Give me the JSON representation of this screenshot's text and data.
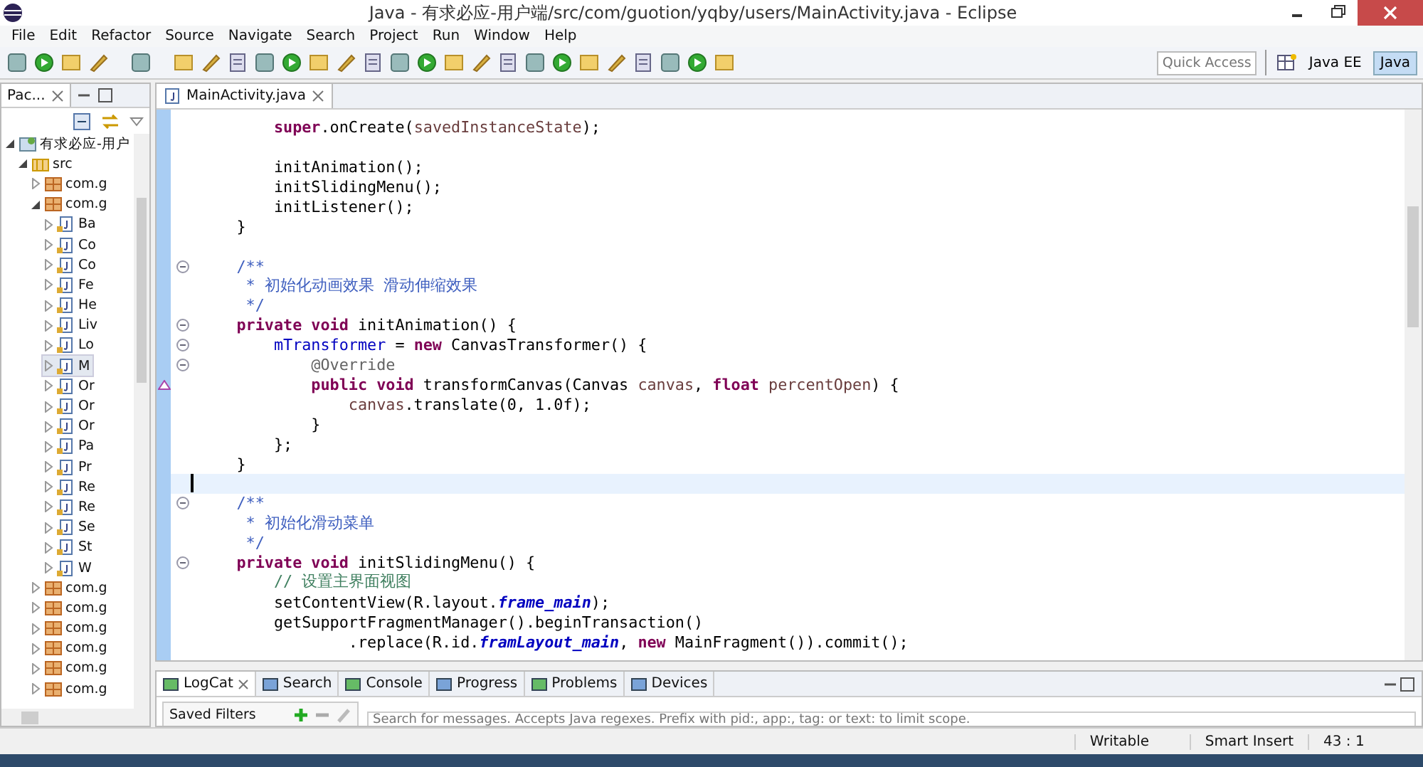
{
  "window": {
    "title": "Java - 有求必应-用户端/src/com/guotion/yqby/users/MainActivity.java - Eclipse"
  },
  "menu": [
    "File",
    "Edit",
    "Refactor",
    "Source",
    "Navigate",
    "Search",
    "Project",
    "Run",
    "Window",
    "Help"
  ],
  "quick_access": {
    "placeholder": "Quick Access"
  },
  "perspectives": [
    {
      "label": "Java EE",
      "selected": false
    },
    {
      "label": "Java",
      "selected": true
    }
  ],
  "package_explorer": {
    "tab": "Pac...",
    "tree": [
      {
        "label": "有求必应-用户",
        "kind": "project",
        "expanded": true,
        "selected": false,
        "children": [
          {
            "label": "src",
            "kind": "source-folder",
            "expanded": true,
            "selected": false,
            "children": [
              {
                "label": "com.g",
                "kind": "package",
                "expanded": false,
                "selected": false
              },
              {
                "label": "com.g",
                "kind": "package",
                "expanded": true,
                "selected": false,
                "children": [
                  {
                    "label": "Ba",
                    "kind": "class",
                    "expanded": false,
                    "selected": false
                  },
                  {
                    "label": "Co",
                    "kind": "class",
                    "expanded": false,
                    "selected": false
                  },
                  {
                    "label": "Co",
                    "kind": "class",
                    "expanded": false,
                    "selected": false
                  },
                  {
                    "label": "Fe",
                    "kind": "class",
                    "expanded": false,
                    "selected": false
                  },
                  {
                    "label": "He",
                    "kind": "class",
                    "expanded": false,
                    "selected": false
                  },
                  {
                    "label": "Liv",
                    "kind": "class",
                    "expanded": false,
                    "selected": false
                  },
                  {
                    "label": "Lo",
                    "kind": "class",
                    "expanded": false,
                    "selected": false
                  },
                  {
                    "label": "M",
                    "kind": "class",
                    "expanded": false,
                    "selected": true
                  },
                  {
                    "label": "Or",
                    "kind": "class",
                    "expanded": false,
                    "selected": false
                  },
                  {
                    "label": "Or",
                    "kind": "class",
                    "expanded": false,
                    "selected": false
                  },
                  {
                    "label": "Or",
                    "kind": "class",
                    "expanded": false,
                    "selected": false
                  },
                  {
                    "label": "Pa",
                    "kind": "class",
                    "expanded": false,
                    "selected": false
                  },
                  {
                    "label": "Pr",
                    "kind": "class",
                    "expanded": false,
                    "selected": false
                  },
                  {
                    "label": "Re",
                    "kind": "class",
                    "expanded": false,
                    "selected": false
                  },
                  {
                    "label": "Re",
                    "kind": "class",
                    "expanded": false,
                    "selected": false
                  },
                  {
                    "label": "Se",
                    "kind": "class",
                    "expanded": false,
                    "selected": false
                  },
                  {
                    "label": "St",
                    "kind": "class",
                    "expanded": false,
                    "selected": false
                  },
                  {
                    "label": "W",
                    "kind": "class",
                    "expanded": false,
                    "selected": false
                  }
                ]
              },
              {
                "label": "com.g",
                "kind": "package",
                "expanded": false,
                "selected": false
              },
              {
                "label": "com.g",
                "kind": "package",
                "expanded": false,
                "selected": false
              },
              {
                "label": "com.g",
                "kind": "package",
                "expanded": false,
                "selected": false
              },
              {
                "label": "com.g",
                "kind": "package",
                "expanded": false,
                "selected": false
              },
              {
                "label": "com.g",
                "kind": "package",
                "expanded": false,
                "selected": false
              },
              {
                "label": "com.g",
                "kind": "package",
                "expanded": false,
                "selected": false
              }
            ]
          }
        ]
      }
    ]
  },
  "editor": {
    "tab": "MainActivity.java",
    "lines": [
      {
        "fold": false,
        "current": false,
        "override": false,
        "tokens": [
          {
            "kind": "kw",
            "text": "        super"
          },
          {
            "kind": "plain",
            "text": ".onCreate("
          },
          {
            "kind": "param",
            "text": "savedInstanceState"
          },
          {
            "kind": "plain",
            "text": ");"
          }
        ]
      },
      {
        "fold": false,
        "current": false,
        "override": false
      },
      {
        "fold": false,
        "current": false,
        "override": false,
        "tokens": [
          {
            "kind": "plain",
            "text": "        initAnimation();"
          }
        ]
      },
      {
        "fold": false,
        "current": false,
        "override": false,
        "tokens": [
          {
            "kind": "plain",
            "text": "        initSlidingMenu();"
          }
        ]
      },
      {
        "fold": false,
        "current": false,
        "override": false,
        "tokens": [
          {
            "kind": "plain",
            "text": "        initListener();"
          }
        ]
      },
      {
        "fold": false,
        "current": false,
        "override": false,
        "tokens": [
          {
            "kind": "plain",
            "text": "    }"
          }
        ]
      },
      {
        "fold": false,
        "current": false,
        "override": false
      },
      {
        "fold": true,
        "current": false,
        "override": false,
        "tokens": [
          {
            "kind": "doc",
            "text": "    /**"
          }
        ]
      },
      {
        "fold": false,
        "current": false,
        "override": false,
        "tokens": [
          {
            "kind": "doc",
            "text": "     * 初始化动画效果 滑动伸缩效果"
          }
        ]
      },
      {
        "fold": false,
        "current": false,
        "override": false,
        "tokens": [
          {
            "kind": "doc",
            "text": "     */"
          }
        ]
      },
      {
        "fold": true,
        "current": false,
        "override": false,
        "tokens": [
          {
            "kind": "kw",
            "text": "    private void"
          },
          {
            "kind": "plain",
            "text": " initAnimation() {"
          }
        ]
      },
      {
        "fold": true,
        "current": false,
        "override": false,
        "tokens": [
          {
            "kind": "field",
            "text": "        mTransformer"
          },
          {
            "kind": "plain",
            "text": " = "
          },
          {
            "kind": "kw",
            "text": "new"
          },
          {
            "kind": "plain",
            "text": " CanvasTransformer() {"
          }
        ]
      },
      {
        "fold": true,
        "current": false,
        "override": false,
        "tokens": [
          {
            "kind": "annotation",
            "text": "            @Override"
          }
        ]
      },
      {
        "fold": false,
        "current": false,
        "override": true,
        "tokens": [
          {
            "kind": "kw",
            "text": "            public void"
          },
          {
            "kind": "plain",
            "text": " transformCanvas(Canvas "
          },
          {
            "kind": "param",
            "text": "canvas"
          },
          {
            "kind": "plain",
            "text": ", "
          },
          {
            "kind": "kw",
            "text": "float"
          },
          {
            "kind": "param",
            "text": " percentOpen"
          },
          {
            "kind": "plain",
            "text": ") {"
          }
        ]
      },
      {
        "fold": false,
        "current": false,
        "override": false,
        "tokens": [
          {
            "kind": "param",
            "text": "                canvas"
          },
          {
            "kind": "plain",
            "text": ".translate(0, 1.0f);"
          }
        ]
      },
      {
        "fold": false,
        "current": false,
        "override": false,
        "tokens": [
          {
            "kind": "plain",
            "text": "            }"
          }
        ]
      },
      {
        "fold": false,
        "current": false,
        "override": false,
        "tokens": [
          {
            "kind": "plain",
            "text": "        };"
          }
        ]
      },
      {
        "fold": false,
        "current": false,
        "override": false,
        "tokens": [
          {
            "kind": "plain",
            "text": "    }"
          }
        ]
      },
      {
        "fold": false,
        "current": true,
        "override": false
      },
      {
        "fold": true,
        "current": false,
        "override": false,
        "tokens": [
          {
            "kind": "doc",
            "text": "    /**"
          }
        ]
      },
      {
        "fold": false,
        "current": false,
        "override": false,
        "tokens": [
          {
            "kind": "doc",
            "text": "     * 初始化滑动菜单"
          }
        ]
      },
      {
        "fold": false,
        "current": false,
        "override": false,
        "tokens": [
          {
            "kind": "doc",
            "text": "     */"
          }
        ]
      },
      {
        "fold": true,
        "current": false,
        "override": false,
        "tokens": [
          {
            "kind": "kw",
            "text": "    private void"
          },
          {
            "kind": "plain",
            "text": " initSlidingMenu() {"
          }
        ]
      },
      {
        "fold": false,
        "current": false,
        "override": false,
        "tokens": [
          {
            "kind": "comment",
            "text": "        // 设置主界面视图"
          }
        ]
      },
      {
        "fold": false,
        "current": false,
        "override": false,
        "tokens": [
          {
            "kind": "plain",
            "text": "        setContentView(R.layout."
          },
          {
            "kind": "static",
            "text": "frame_main"
          },
          {
            "kind": "plain",
            "text": ");"
          }
        ]
      },
      {
        "fold": false,
        "current": false,
        "override": false,
        "tokens": [
          {
            "kind": "plain",
            "text": "        getSupportFragmentManager().beginTransaction()"
          }
        ]
      },
      {
        "fold": false,
        "current": false,
        "override": false,
        "tokens": [
          {
            "kind": "plain",
            "text": "                .replace(R.id."
          },
          {
            "kind": "static",
            "text": "framLayout_main"
          },
          {
            "kind": "plain",
            "text": ", "
          },
          {
            "kind": "kw",
            "text": "new"
          },
          {
            "kind": "plain",
            "text": " MainFragment()).commit();"
          }
        ]
      }
    ]
  },
  "bottom_panel": {
    "tabs": [
      {
        "label": "LogCat",
        "selected": true
      },
      {
        "label": "Search",
        "selected": false
      },
      {
        "label": "Console",
        "selected": false
      },
      {
        "label": "Progress",
        "selected": false
      },
      {
        "label": "Problems",
        "selected": false
      },
      {
        "label": "Devices",
        "selected": false
      }
    ],
    "saved_filters": "Saved Filters",
    "search": {
      "placeholder": "Search for messages. Accepts Java regexes. Prefix with pid:, app:, tag: or text: to limit scope."
    }
  },
  "status_bar": [
    "Writable",
    "Smart Insert",
    "43 : 1"
  ]
}
